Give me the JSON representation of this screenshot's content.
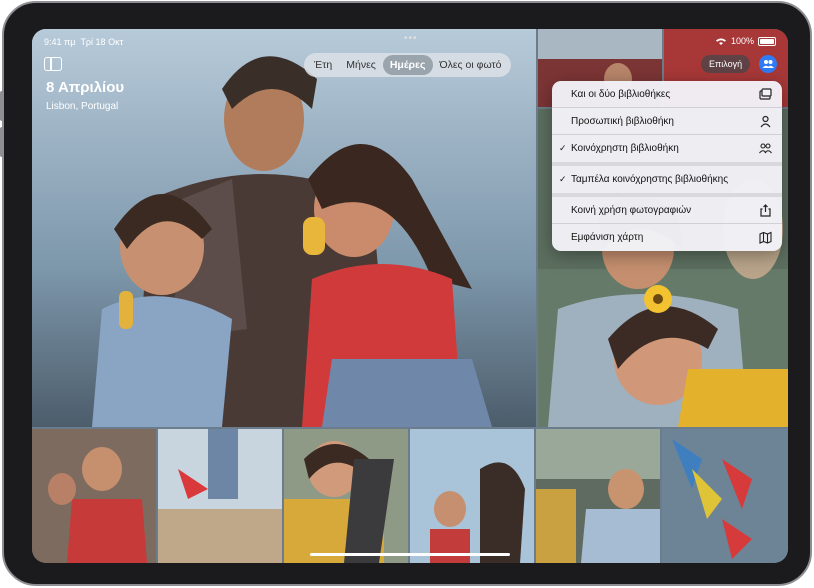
{
  "status_bar": {
    "time": "9:41 πμ",
    "date": "Τρί 18 Οκτ",
    "battery": "100%"
  },
  "header": {
    "title": "8 Απριλίου",
    "subtitle": "Lisbon, Portugal"
  },
  "view_segments": [
    {
      "label": "Έτη",
      "active": false
    },
    {
      "label": "Μήνες",
      "active": false
    },
    {
      "label": "Ημέρες",
      "active": true
    },
    {
      "label": "Όλες οι φωτό",
      "active": false
    }
  ],
  "toolbar": {
    "select_label": "Επιλογή"
  },
  "menu": {
    "items": [
      {
        "label": "Και οι δύο βιβλιοθήκες",
        "icon": "photo-stack-icon",
        "checked": false
      },
      {
        "label": "Προσωπική βιβλιοθήκη",
        "icon": "person-icon",
        "checked": false
      },
      {
        "label": "Κοινόχρηστη βιβλιοθήκη",
        "icon": "people-icon",
        "checked": true
      },
      {
        "label": "Ταμπέλα κοινόχρηστης βιβλιοθήκης",
        "icon": "",
        "checked": true
      },
      {
        "label": "Κοινή χρήση φωτογραφιών",
        "icon": "share-icon",
        "checked": false
      },
      {
        "label": "Εμφάνιση χάρτη",
        "icon": "map-icon",
        "checked": false
      }
    ]
  },
  "colors": {
    "accent": "#2f7bf6",
    "menu_bg": "#f2f2f7",
    "device_frame": "#1b1b1d"
  }
}
